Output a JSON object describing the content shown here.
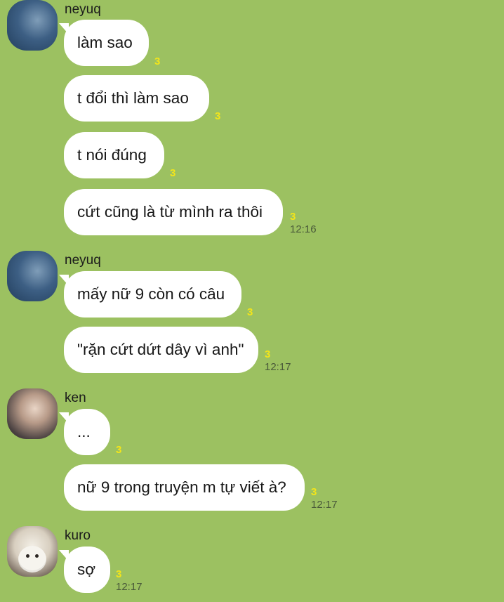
{
  "groups": [
    {
      "sender": "neyuq",
      "avatar": "neyuq-avatar",
      "messages": [
        {
          "text": "làm sao",
          "unread": "3",
          "time": ""
        },
        {
          "text": "t đổi thì làm sao",
          "unread": "3",
          "time": ""
        },
        {
          "text": "t nói đúng",
          "unread": "3",
          "time": ""
        },
        {
          "text": "cứt cũng là từ mình ra thôi",
          "unread": "3",
          "time": "12:16"
        }
      ]
    },
    {
      "sender": "neyuq",
      "avatar": "neyuq-avatar",
      "messages": [
        {
          "text": "mấy nữ 9 còn có câu",
          "unread": "3",
          "time": ""
        },
        {
          "text": "\"rặn cứt dứt dây vì anh\"",
          "unread": "3",
          "time": "12:17"
        }
      ]
    },
    {
      "sender": "ken",
      "avatar": "ken-avatar",
      "messages": [
        {
          "text": "...",
          "unread": "3",
          "time": ""
        },
        {
          "text": "nữ 9 trong truyện m tự viết à?",
          "unread": "3",
          "time": "12:17"
        }
      ]
    },
    {
      "sender": "kuro",
      "avatar": "kuro-avatar",
      "messages": [
        {
          "text": "sợ",
          "unread": "3",
          "time": "12:17"
        }
      ]
    }
  ]
}
